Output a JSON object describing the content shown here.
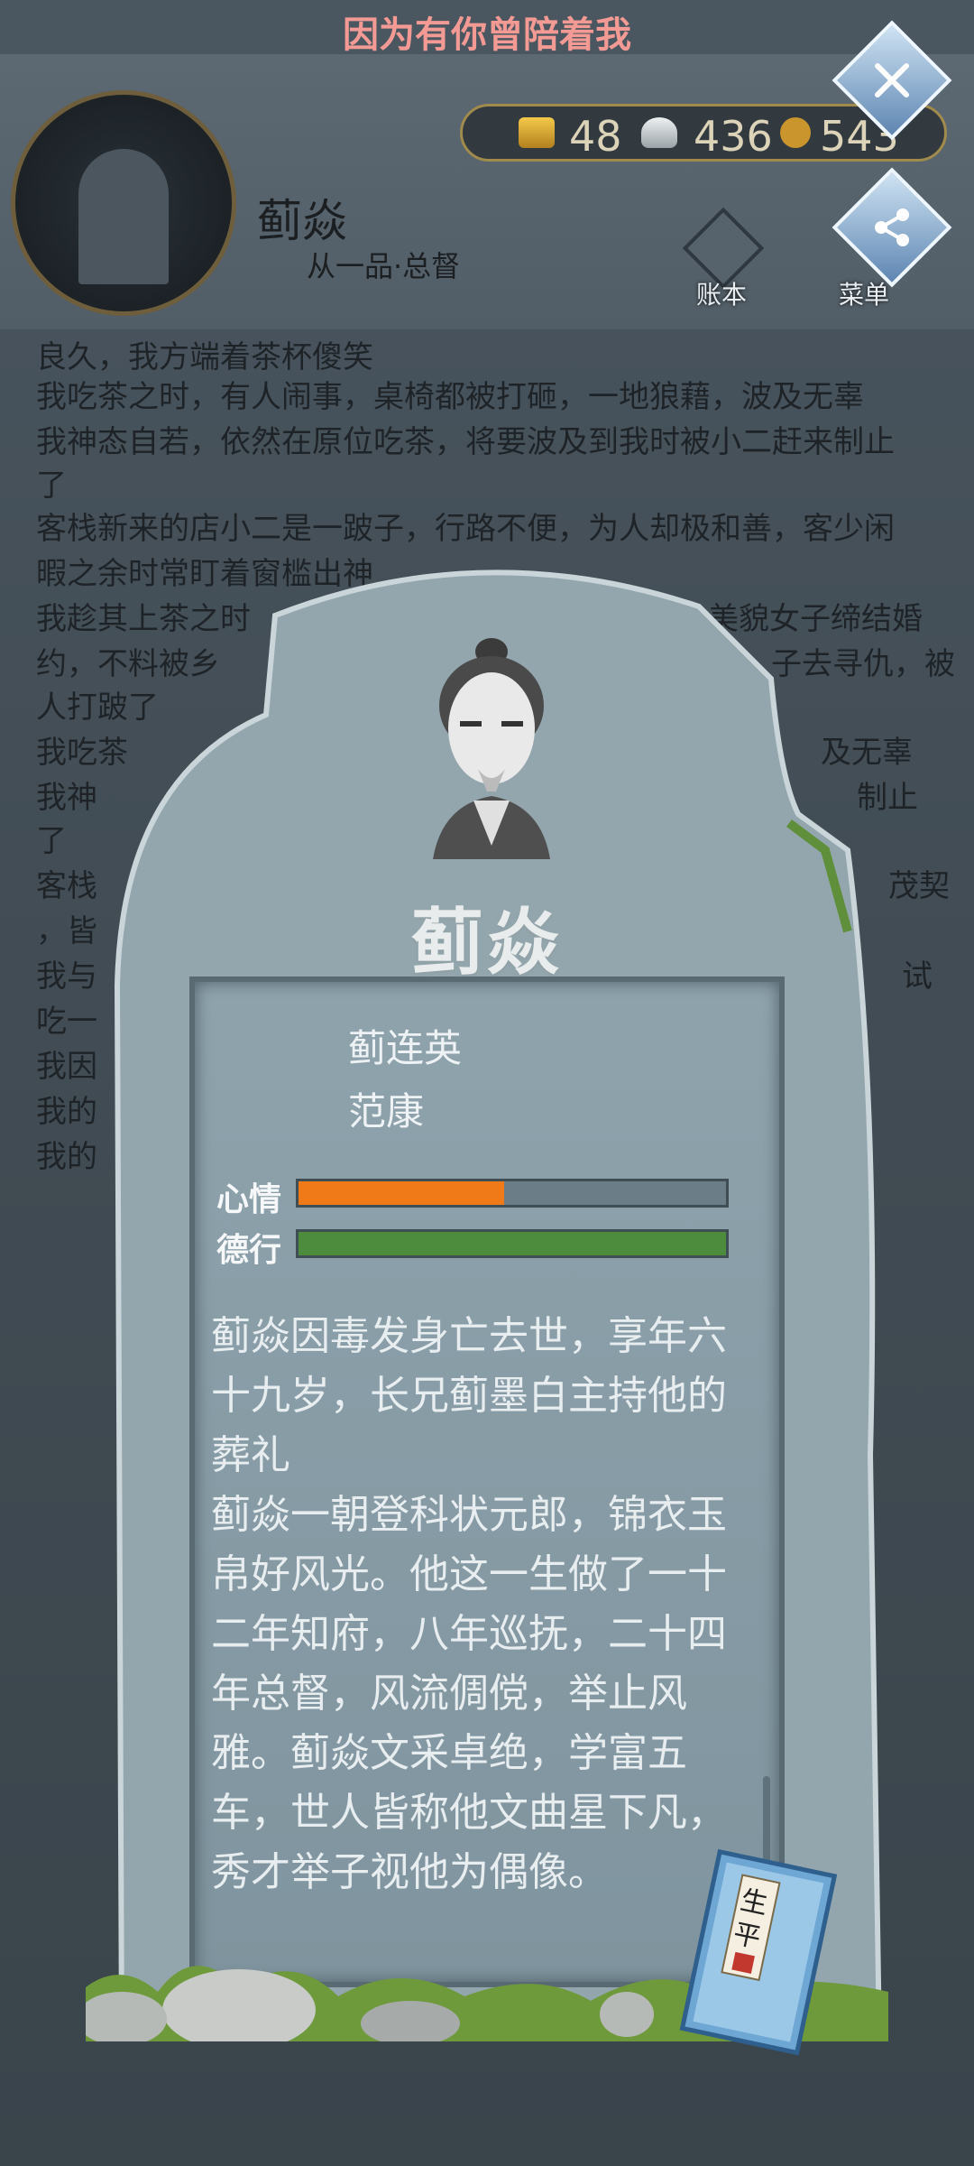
{
  "header": {
    "title_banner": "因为有你曾陪着我",
    "character_name": "蓟焱",
    "rank": "从一品·总督",
    "currency": [
      {
        "icon": "gold-ingot-icon",
        "value": "48"
      },
      {
        "icon": "silver-ingot-icon",
        "value": "436"
      },
      {
        "icon": "copper-coin-icon",
        "value": "543"
      }
    ],
    "side_tabs": {
      "ledger": "账本",
      "menu": "菜单"
    }
  },
  "background_log": [
    "良久，我方端着茶杯傻笑",
    "我吃茶之时，有人闹事，桌椅都被打砸，一地狼藉，波及无辜",
    "我神态自若，依然在原位吃茶，将要波及到我时被小二赶来制止",
    "了",
    "客栈新来的店小二是一跛子，行路不便，为人却极和善，客少闲",
    "暇之余时常盯着窗槛出神",
    "我趁其上茶之时",
    "约，不料被乡",
    "人打跛了",
    "我吃茶",
    "我神",
    "了",
    "客栈",
    "，皆",
    "我与",
    "吃一",
    "我因",
    "我的",
    "我的"
  ],
  "background_log_partials": [
    "美貌女子缔结婚",
    "子去寻仇，被",
    "及无辜",
    "制止",
    "茂契",
    "试"
  ],
  "tombstone": {
    "name": "蓟焱",
    "relatives": [
      "蓟连英",
      "范康"
    ],
    "stats": [
      {
        "label": "心情",
        "value": 0.48,
        "color": "#f07a17"
      },
      {
        "label": "德行",
        "value": 1.0,
        "color": "#4c8c3c"
      }
    ],
    "biography": [
      "蓟焱因毒发身亡去世，享年六十九岁，长兄蓟墨白主持他的葬礼",
      "蓟焱一朝登科状元郎，锦衣玉帛好风光。他这一生做了一十二年知府，八年巡抚，二十四年总督，风流倜傥，举止风雅。蓟焱文采卓绝，学富五车，世人皆称他文曲星下凡，秀才举子视他为偶像。"
    ],
    "book_label": "生平"
  },
  "colors": {
    "title": "#f29a93",
    "stone": "#93a6ad",
    "mood": "#f07a17",
    "virtue": "#4c8c3c"
  }
}
